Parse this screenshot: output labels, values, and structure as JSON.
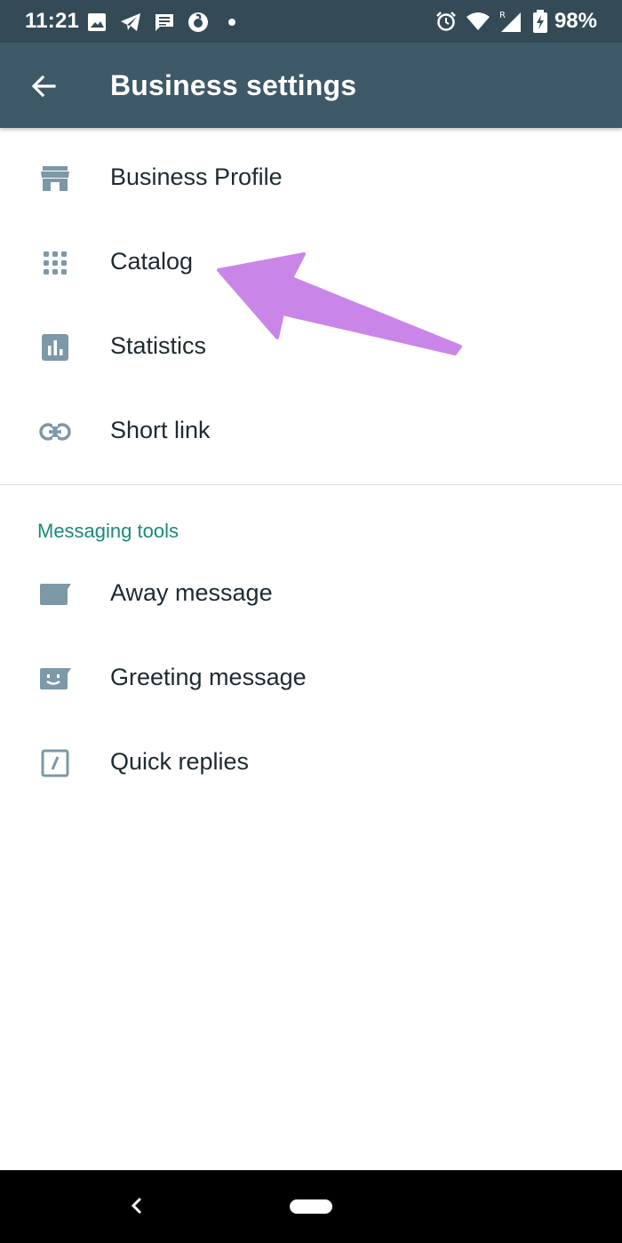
{
  "status_bar": {
    "time": "11:21",
    "battery": "98%",
    "left_icons": [
      "image-icon",
      "telegram-icon",
      "message-icon",
      "vodafone-icon",
      "dot-icon"
    ],
    "right_icons": [
      "alarm-icon",
      "wifi-icon",
      "signal-roaming-icon",
      "battery-charging-icon"
    ]
  },
  "appbar": {
    "title": "Business settings",
    "back_icon": "arrow-back-icon"
  },
  "items": [
    {
      "label": "Business Profile",
      "icon": "storefront-icon"
    },
    {
      "label": "Catalog",
      "icon": "grid-icon"
    },
    {
      "label": "Statistics",
      "icon": "bar-chart-icon"
    },
    {
      "label": "Short link",
      "icon": "link-icon"
    }
  ],
  "messaging_tools": {
    "header": "Messaging tools",
    "items": [
      {
        "label": "Away message",
        "icon": "away-message-icon"
      },
      {
        "label": "Greeting message",
        "icon": "greeting-message-icon"
      },
      {
        "label": "Quick replies",
        "icon": "quick-replies-icon"
      }
    ]
  },
  "annotation": {
    "arrow_color": "#c986e8"
  },
  "colors": {
    "statusbar": "#344b57",
    "appbar": "#3e5967",
    "accent": "#1a8a7c",
    "icon": "#7d98a6"
  }
}
